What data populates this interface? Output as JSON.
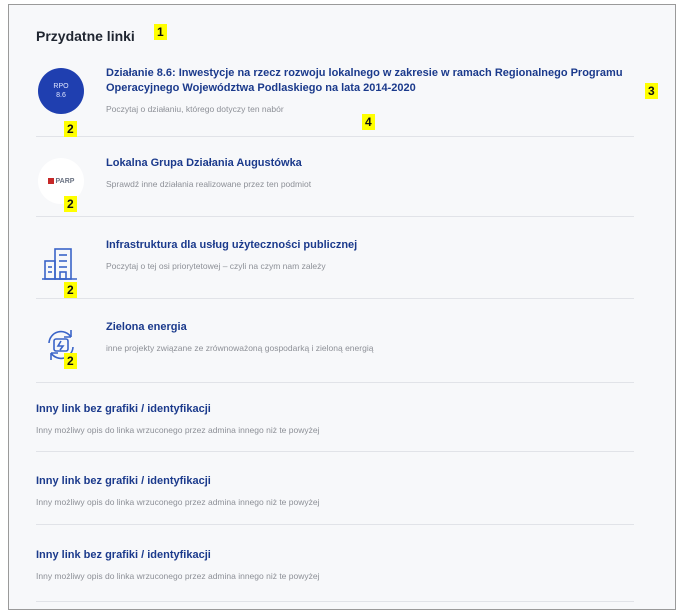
{
  "page": {
    "title": "Przydatne linki",
    "annotation_title": "1"
  },
  "items": [
    {
      "thumb_line1": "RPO",
      "thumb_line2": "8.6",
      "link": "Działanie 8.6: Inwestycje na rzecz rozwoju lokalnego w zakresie w ramach Regionalnego Programu Operacyjnego Województwa Podlaskiego na lata 2014-2020",
      "desc": "Poczytaj o działaniu, którego dotyczy ten nabór",
      "tag_thumb": "2",
      "tag_link": "3",
      "tag_desc": "4"
    },
    {
      "thumb_text": "PARP",
      "link": "Lokalna Grupa Działania Augustówka",
      "desc": "Sprawdź inne działania realizowane przez ten podmiot",
      "tag_thumb": "2"
    },
    {
      "link": "Infrastruktura dla usług użyteczności publicznej",
      "desc": "Poczytaj o tej osi priorytetowej – czyli na czym nam zależy",
      "tag_thumb": "2"
    },
    {
      "link": "Zielona energia",
      "desc": "inne projekty związane ze zrównoważoną gospodarką i zieloną energią",
      "tag_thumb": "2"
    },
    {
      "link": "Inny link bez grafiki / identyfikacji",
      "desc": "Inny możliwy opis do linka wrzuconego przez admina innego niż te powyżej"
    },
    {
      "link": "Inny link bez grafiki / identyfikacji",
      "desc": "Inny możliwy opis do linka wrzuconego przez admina innego niż te powyżej"
    },
    {
      "link": "Inny link bez grafiki / identyfikacji",
      "desc": "Inny możliwy opis do linka wrzuconego przez admina innego niż te powyżej"
    }
  ],
  "colors": {
    "link": "#1b3a8c",
    "description": "#8d9097",
    "annotation": "#ffff00",
    "rpo_circle": "#1f3fb0"
  }
}
